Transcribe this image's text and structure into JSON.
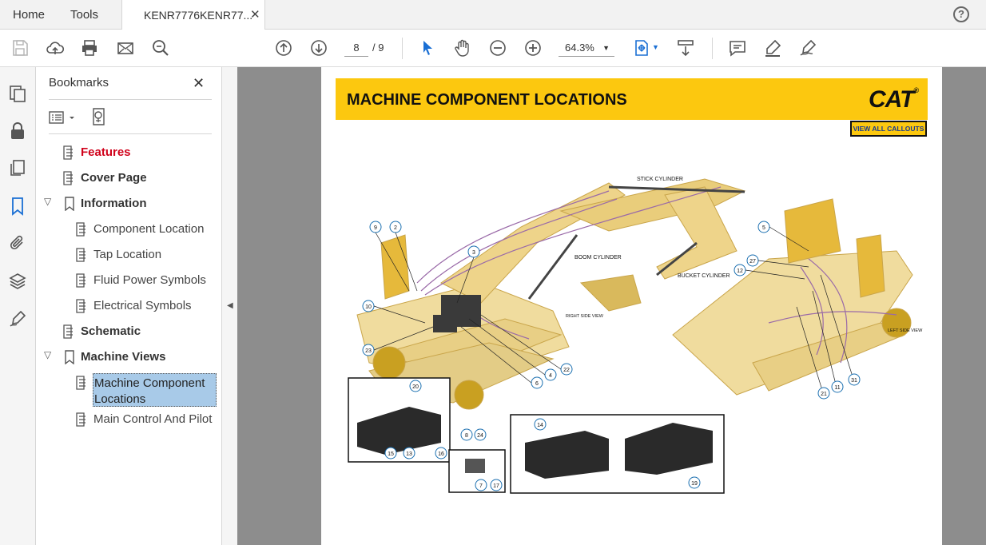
{
  "tabs": {
    "home": "Home",
    "tools": "Tools",
    "document": "KENR7776KENR77...",
    "close": "✕",
    "help": "?"
  },
  "toolbar": {
    "current_page": "8",
    "total_pages": "/ 9",
    "zoom": "64.3%"
  },
  "bookmarks": {
    "title": "Bookmarks",
    "close": "✕",
    "items": [
      {
        "label": "Features"
      },
      {
        "label": "Cover Page"
      },
      {
        "label": "Information"
      },
      {
        "label": "Component Location"
      },
      {
        "label": "Tap Location"
      },
      {
        "label": "Fluid Power Symbols"
      },
      {
        "label": "Electrical Symbols"
      },
      {
        "label": "Schematic"
      },
      {
        "label": "Machine Views"
      },
      {
        "label": "Machine Component Locations"
      },
      {
        "label": "Main Control And Pilot"
      }
    ]
  },
  "page": {
    "heading": "MACHINE COMPONENT LOCATIONS",
    "logo": "CAT",
    "logo_mark": "®",
    "view_all_callouts": "VIEW ALL CALLOUTS",
    "labels": {
      "stick": "STICK CYLINDER",
      "boom": "BOOM CYLINDER",
      "bucket": "BUCKET CYLINDER",
      "right": "RIGHT SIDE VIEW",
      "left": "LEFT SIDE VIEW"
    },
    "callouts": [
      "9",
      "2",
      "3",
      "10",
      "23",
      "4",
      "22",
      "6",
      "5",
      "27",
      "12",
      "21",
      "11",
      "31",
      "20",
      "8",
      "24",
      "14",
      "15",
      "13",
      "16",
      "7",
      "17",
      "19"
    ]
  },
  "colors": {
    "banner": "#fcc80f",
    "accent_blue": "#1a6fd4",
    "features_red": "#d0021b",
    "selection": "#a8cae8"
  }
}
